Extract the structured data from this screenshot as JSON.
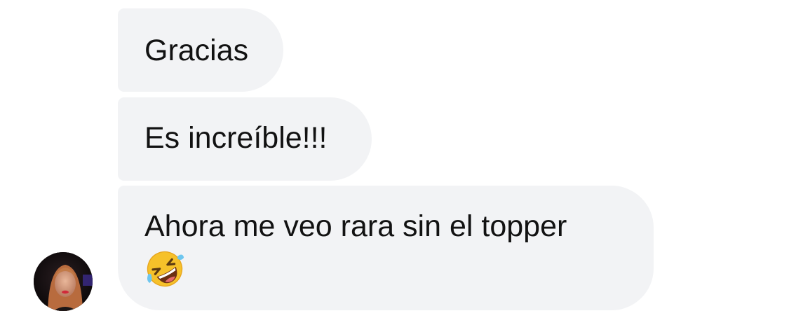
{
  "conversation": {
    "messages": [
      {
        "text": "Gracias"
      },
      {
        "text": "Es increíble!!!"
      },
      {
        "text": "Ahora me veo rara sin el topper",
        "emoji": "rolling-on-the-floor-laughing-emoji"
      }
    ]
  },
  "colors": {
    "bubble_background": "#f2f3f5",
    "text": "#121212",
    "background": "#ffffff"
  },
  "icons": {
    "avatar": "contact-profile-photo"
  }
}
